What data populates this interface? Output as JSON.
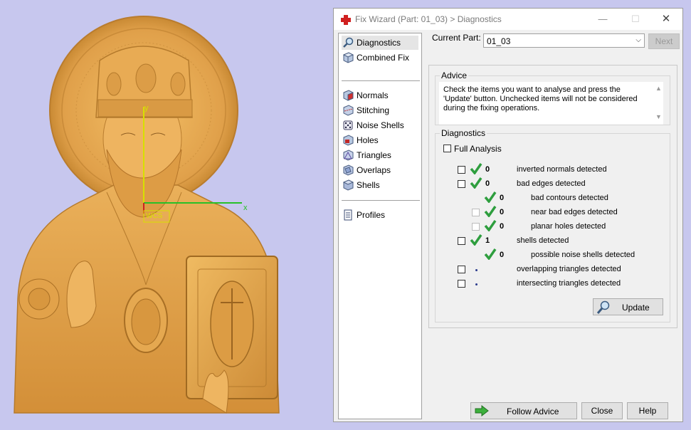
{
  "viewport": {
    "axis_labels": {
      "y": "y",
      "x": "x",
      "origin": "WCS"
    }
  },
  "dialog": {
    "title": "Fix Wizard (Part: 01_03) > Diagnostics",
    "window_controls": {
      "minimize": "—",
      "maximize": "☐",
      "close": "✕"
    }
  },
  "nav": {
    "items": [
      {
        "label": "Diagnostics",
        "icon": "magnifier-icon"
      },
      {
        "label": "Combined Fix",
        "icon": "cube-icon"
      },
      {
        "label": "Normals",
        "icon": "cube-red-face-icon"
      },
      {
        "label": "Stitching",
        "icon": "cube-stitch-icon"
      },
      {
        "label": "Noise Shells",
        "icon": "dice-icon"
      },
      {
        "label": "Holes",
        "icon": "cube-hole-icon"
      },
      {
        "label": "Triangles",
        "icon": "triangle-cube-icon"
      },
      {
        "label": "Overlaps",
        "icon": "overlap-cube-icon"
      },
      {
        "label": "Shells",
        "icon": "shell-cube-icon"
      },
      {
        "label": "Profiles",
        "icon": "document-icon"
      }
    ]
  },
  "current_part": {
    "label": "Current Part:",
    "value": "01_03"
  },
  "next_button": "Next",
  "advice": {
    "title": "Advice",
    "text": "Check the items you want to analyse and press the 'Update' button. Unchecked items will not be considered during the fixing operations."
  },
  "diagnostics": {
    "title": "Diagnostics",
    "full_analysis": "Full Analysis",
    "rows": [
      {
        "count": "0",
        "label": "inverted normals detected"
      },
      {
        "count": "0",
        "label": "bad edges detected"
      },
      {
        "count": "0",
        "label": "bad contours detected"
      },
      {
        "count": "0",
        "label": "near bad edges detected"
      },
      {
        "count": "0",
        "label": "planar holes detected"
      },
      {
        "count": "1",
        "label": "shells detected"
      },
      {
        "count": "0",
        "label": "possible noise shells detected"
      },
      {
        "count": "",
        "label": "overlapping triangles detected"
      },
      {
        "count": "",
        "label": "intersecting triangles detected"
      }
    ],
    "update_button": "Update"
  },
  "footer": {
    "follow_advice": "Follow Advice",
    "close": "Close",
    "help": "Help"
  },
  "colors": {
    "accent_check": "#2e9e3e",
    "model": "#e3a040",
    "viewport_bg": "#c7c7ee"
  }
}
